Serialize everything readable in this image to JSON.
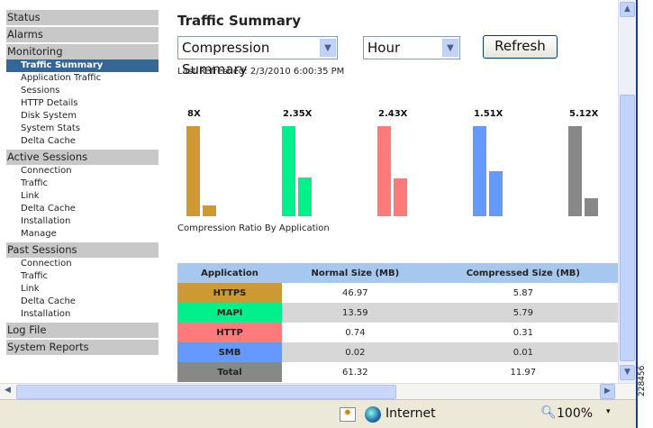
{
  "sidebar": {
    "status": "Status",
    "alarms": "Alarms",
    "monitoring": "Monitoring",
    "monitoring_items": [
      "Traffic Summary",
      "Application Traffic",
      "Sessions",
      "HTTP Details",
      "Disk System",
      "System Stats",
      "Delta Cache"
    ],
    "active_sessions": "Active Sessions",
    "active_items": [
      "Connection",
      "Traffic",
      "Link",
      "Delta Cache",
      "Installation",
      "Manage"
    ],
    "past_sessions": "Past Sessions",
    "past_items": [
      "Connection",
      "Traffic",
      "Link",
      "Delta Cache",
      "Installation"
    ],
    "log_file": "Log File",
    "system_reports": "System Reports"
  },
  "main": {
    "title": "Traffic Summary",
    "report_select": "Compression Summary",
    "period_select": "Hour",
    "refresh_label": "Refresh",
    "last_refreshed": "Last Refreshed: 2/3/2010 6:00:35 PM"
  },
  "chart_data": {
    "type": "bar",
    "title": "Compression Ratio By Application",
    "categories": [
      "HTTPS",
      "MAPI",
      "HTTP",
      "SMB",
      "Total"
    ],
    "ratio_labels": [
      "8X",
      "2.35X",
      "2.43X",
      "1.51X",
      "5.12X"
    ],
    "series": [
      {
        "name": "Normal Size (MB)",
        "values": [
          46.97,
          13.59,
          0.74,
          0.02,
          61.32
        ]
      },
      {
        "name": "Compressed Size (MB)",
        "values": [
          5.87,
          5.79,
          0.31,
          0.01,
          11.97
        ]
      }
    ],
    "colors": [
      "#cc9933",
      "#00f08c",
      "#ff7b7b",
      "#6699ff",
      "#888888"
    ]
  },
  "table": {
    "headers": [
      "Application",
      "Normal Size (MB)",
      "Compressed Size (MB)"
    ],
    "rows": [
      [
        "HTTPS",
        "46.97",
        "5.87"
      ],
      [
        "MAPI",
        "13.59",
        "5.79"
      ],
      [
        "HTTP",
        "0.74",
        "0.31"
      ],
      [
        "SMB",
        "0.02",
        "0.01"
      ],
      [
        "Total",
        "61.32",
        "11.97"
      ]
    ]
  },
  "statusbar": {
    "zone": "Internet",
    "zoom": "100%"
  },
  "figure_id": "228456"
}
